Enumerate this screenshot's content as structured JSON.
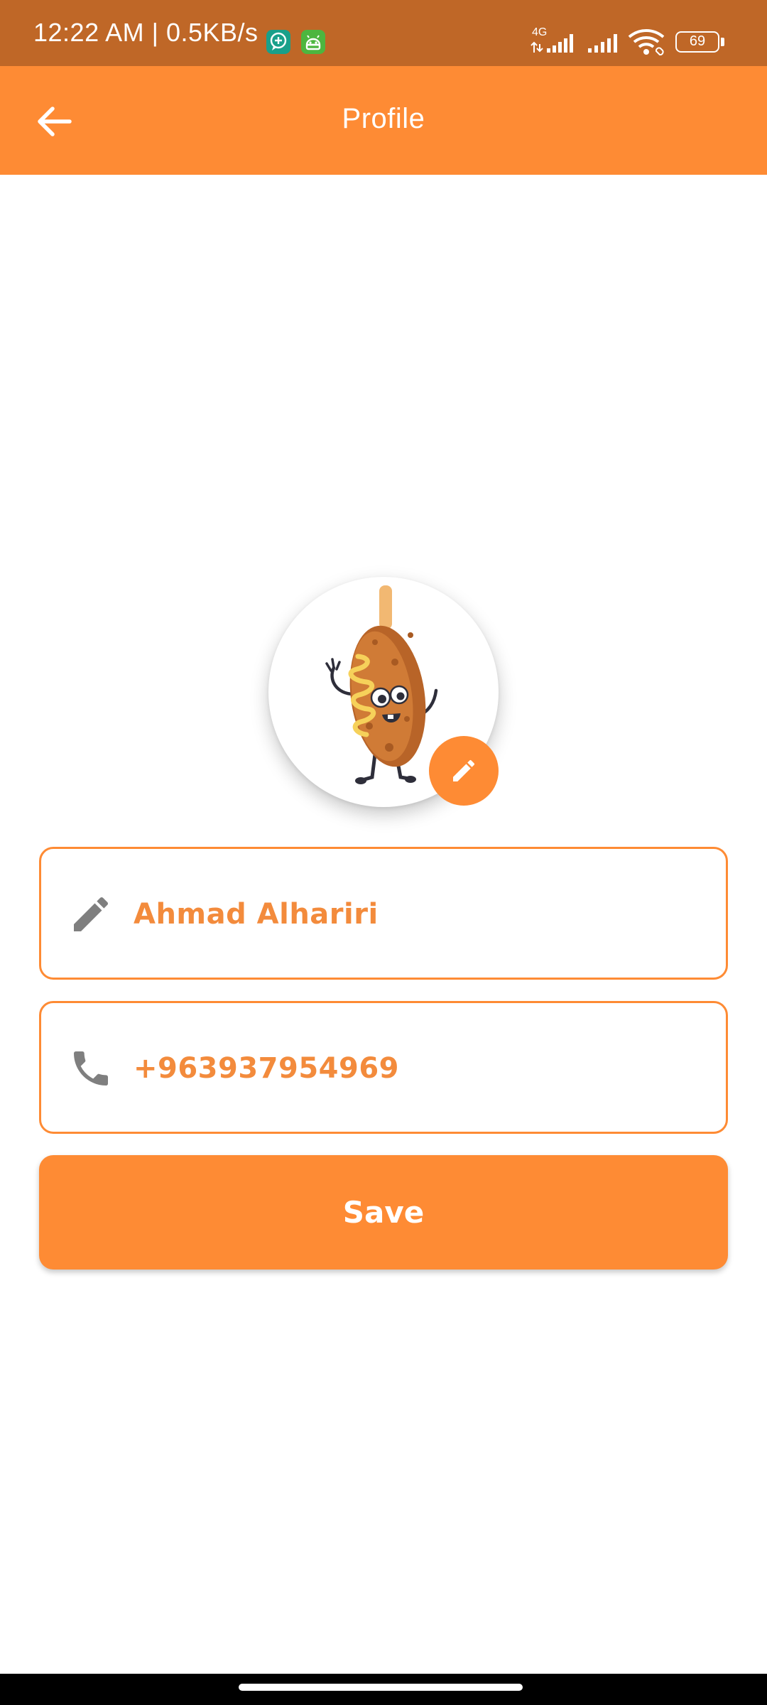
{
  "status_bar": {
    "time_speed": "12:22 AM | 0.5KB/s",
    "network_type": "4G",
    "battery_level": "69",
    "icons": [
      "chat-plus-icon",
      "android-robot-icon",
      "signal-4g-icon",
      "signal-icon",
      "wifi-icon",
      "battery-icon"
    ]
  },
  "app_bar": {
    "title": "Profile",
    "back_icon": "arrow-left-icon"
  },
  "profile": {
    "avatar_icon": "hotdog-mascot-avatar",
    "edit_avatar_icon": "pencil-icon",
    "name_field": {
      "value": "Ahmad Alhariri",
      "icon": "pencil-icon"
    },
    "phone_field": {
      "value": "+963937954969",
      "icon": "phone-icon"
    },
    "save_label": "Save"
  },
  "colors": {
    "status_bar": "#bf6727",
    "accent": "#fe8b34",
    "field_text": "#f38b3c",
    "icon_gray": "#7f7f7f",
    "background": "#ffffff"
  }
}
